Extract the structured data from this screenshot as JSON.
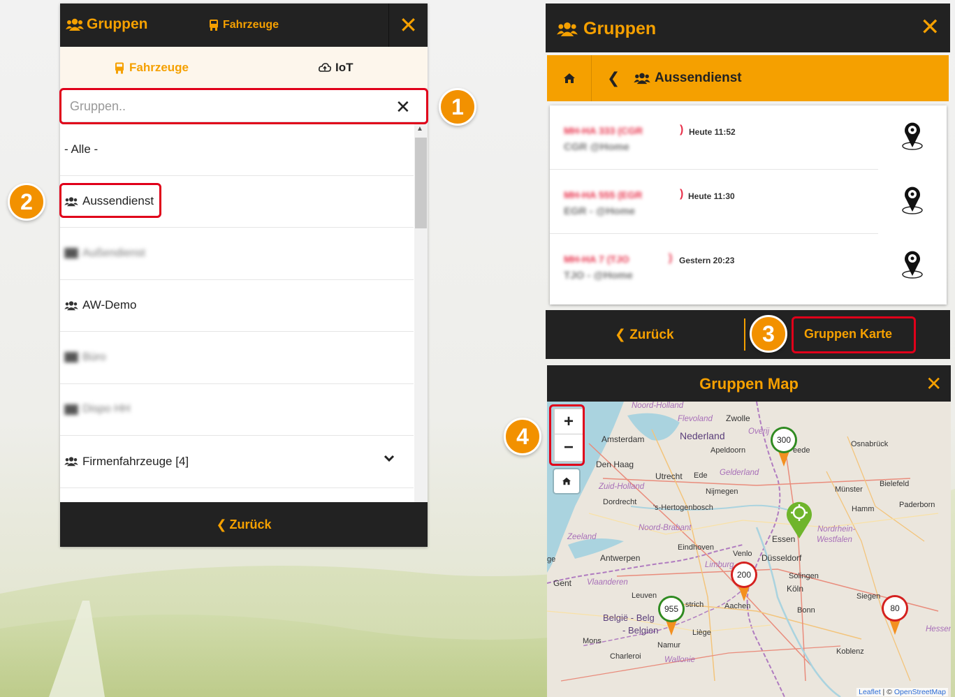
{
  "left_panel": {
    "header_title": "Gruppen",
    "header_link": "Fahrzeuge",
    "tab_vehicles": "Fahrzeuge",
    "tab_iot": "IoT",
    "search_placeholder": "Gruppen..",
    "groups": [
      {
        "label": "- Alle -",
        "icon": "none",
        "blurred": false
      },
      {
        "label": "Aussendienst",
        "icon": "users-icon",
        "blurred": false
      },
      {
        "label": "Außendienst",
        "icon": "users-icon",
        "blurred": true
      },
      {
        "label": "AW-Demo",
        "icon": "users-icon",
        "blurred": false
      },
      {
        "label": "Büro",
        "icon": "users-icon",
        "blurred": true
      },
      {
        "label": "Dispo HH",
        "icon": "users-icon",
        "blurred": true
      },
      {
        "label": "Firmenfahrzeuge [4]",
        "icon": "users-icon",
        "blurred": false,
        "expandable": true
      }
    ],
    "footer_back": "Zurück"
  },
  "right_panel": {
    "header_title": "Gruppen",
    "breadcrumb_group": "Aussendienst",
    "vehicles": [
      {
        "plate": "MH-HA 333 (CGR",
        "time": "Heute 11:52",
        "driver": "CGR @Home"
      },
      {
        "plate": "MH-HA 555 (EGR",
        "time": "Heute 11:30",
        "driver": "EGR - @Home"
      },
      {
        "plate": "MH-HA 7 (TJO",
        "time": "Gestern 20:23",
        "driver": "TJO - @Home"
      }
    ],
    "footer_back": "Zurück",
    "footer_map_button": "Gruppen Karte"
  },
  "map_panel": {
    "title": "Gruppen Map",
    "zoom_in": "+",
    "zoom_out": "−",
    "attribution_leaflet": "Leaflet",
    "attribution_sep": " | © ",
    "attribution_osm": "OpenStreetMap",
    "cities": {
      "amsterdam": "Amsterdam",
      "nederland": "Nederland",
      "zwolle": "Zwolle",
      "apeldoorn": "Apeldoorn",
      "den_haag": "Den Haag",
      "utrecht": "Utrecht",
      "ede": "Ede",
      "nijmegen": "Nijmegen",
      "dordrecht": "Dordrecht",
      "hertogenbosch": "'s-Hertogenbosch",
      "eindhoven": "Eindhoven",
      "venlo": "Venlo",
      "essen": "Essen",
      "duesseldorf": "Düsseldorf",
      "antwerpen": "Antwerpen",
      "gent": "Gent",
      "leuven": "Leuven",
      "maastricht": "strich",
      "aachen": "Aachen",
      "koeln": "Köln",
      "solingen": "Solingen",
      "bonn": "Bonn",
      "siegen": "Siegen",
      "belgie": "België - Belg",
      "belgien": "- Belgien",
      "liege": "Liège",
      "namur": "Namur",
      "mons": "Mons",
      "charleroi": "Charleroi",
      "koblenz": "Koblenz",
      "osnabrueck": "Osnabrück",
      "bielefeld": "Bielefeld",
      "muenster": "Münster",
      "hamm": "Hamm",
      "paderborn": "Paderborn",
      "rheede": "eede",
      "ge": "ge"
    },
    "regions": {
      "noord_holland": "Noord-Holland",
      "flevoland": "Flevoland",
      "overijssel": "Overij",
      "gelderland": "Gelderland",
      "zuid_holland": "Zuid-Holland",
      "zeeland": "Zeeland",
      "noord_brabant": "Noord-Brabant",
      "limburg": "Limburg",
      "vlaanderen": "Vlaanderen",
      "nordrhein": "Nordrhein-",
      "westfalen": "Westfalen",
      "wallonie": "Wallonie",
      "hessen": "Hessen"
    },
    "clusters": [
      {
        "count": "300",
        "ring": "#2e8b22"
      },
      {
        "count": "200",
        "ring": "#d42020"
      },
      {
        "count": "955",
        "ring": "#2e8b22"
      },
      {
        "count": "80",
        "ring": "#d42020"
      }
    ]
  },
  "annotations": [
    "1",
    "2",
    "3",
    "4"
  ],
  "colors": {
    "accent": "#f5a000",
    "header_bg": "#222222",
    "highlight": "#e0001a",
    "badge": "#f29100"
  }
}
